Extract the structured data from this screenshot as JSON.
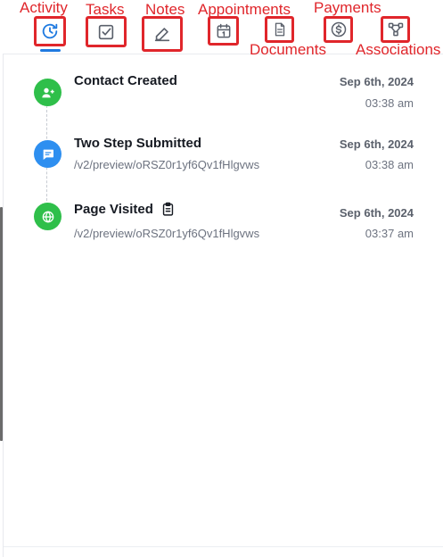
{
  "tabs": [
    {
      "key": "activity",
      "label": "Activity",
      "icon": "activity-clock-icon",
      "active": true
    },
    {
      "key": "tasks",
      "label": "Tasks",
      "icon": "checkbox-icon",
      "active": false
    },
    {
      "key": "notes",
      "label": "Notes",
      "icon": "pencil-icon",
      "active": false
    },
    {
      "key": "appointments",
      "label": "Appointments",
      "icon": "calendar-icon",
      "active": false
    },
    {
      "key": "documents",
      "label": "Documents",
      "icon": "document-icon",
      "active": false
    },
    {
      "key": "payments",
      "label": "Payments",
      "icon": "dollar-circle-icon",
      "active": false
    },
    {
      "key": "associations",
      "label": "Associations",
      "icon": "share-nodes-icon",
      "active": false
    }
  ],
  "events": [
    {
      "title": "Contact Created",
      "subtitle": "",
      "date": "Sep 6th, 2024",
      "time": "03:38 am",
      "icon": "add-user-icon",
      "color": "#2fbf4a"
    },
    {
      "title": "Two Step Submitted",
      "subtitle": "/v2/preview/oRSZ0r1yf6Qv1fHlgvws",
      "date": "Sep 6th, 2024",
      "time": "03:38 am",
      "icon": "message-icon",
      "color": "#2e8ff0"
    },
    {
      "title": "Page Visited",
      "subtitle": "/v2/preview/oRSZ0r1yf6Qv1fHlgvws",
      "date": "Sep 6th, 2024",
      "time": "03:37 am",
      "icon": "globe-icon",
      "color": "#2fbf4a",
      "extra_icon": "clipboard-icon"
    }
  ],
  "colors": {
    "accent": "#1f7ae0",
    "annotation": "#e0262b",
    "green": "#2fbf4a",
    "blue": "#2e8ff0"
  }
}
